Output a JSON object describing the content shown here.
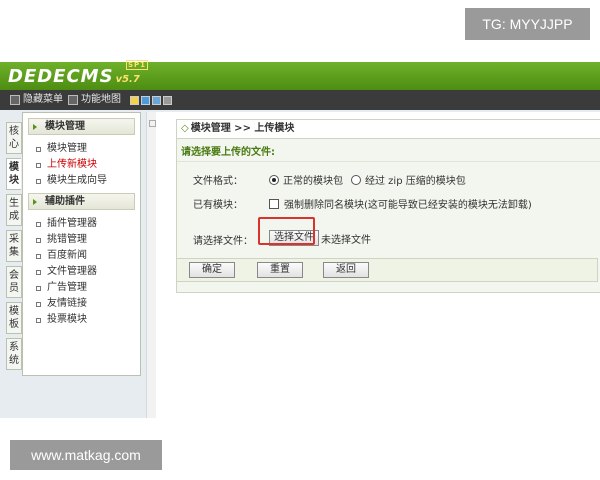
{
  "watermarks": {
    "top": "TG: MYYJJPP",
    "bottom": "www.matkag.com"
  },
  "app": {
    "logo": "DEDECMS",
    "version": "v5.7",
    "badge": "SP1"
  },
  "toolbar": {
    "hide_menu": "隐藏菜单",
    "sitemap": "功能地图"
  },
  "swatch_colors": [
    "#f3d34a",
    "#4a9be0",
    "#6aa6d8",
    "#9a9a9a"
  ],
  "vtabs": [
    "核心",
    "模块",
    "生成",
    "采集",
    "会员",
    "模板",
    "系统"
  ],
  "menu": {
    "group1": {
      "title": "模块管理",
      "items": [
        "模块管理",
        "上传新模块",
        "模块生成向导"
      ]
    },
    "group2": {
      "title": "辅助插件",
      "items": [
        "插件管理器",
        "挑错管理",
        "百度新闻",
        "文件管理器",
        "广告管理",
        "友情链接",
        "投票模块"
      ]
    }
  },
  "main": {
    "breadcrumb": "模块管理 >> 上传模块",
    "breadcrumb_mark": "◇",
    "subtitle": "请选择要上传的文件:",
    "format_label": "文件格式：",
    "format_opt1": "正常的模块包",
    "format_opt2": "经过 zip 压缩的模块包",
    "exists_label": "已有模块：",
    "exists_opt": "强制删除同名模块(这可能导致已经安装的模块无法卸载)",
    "file_label": "请选择文件：",
    "file_button": "选择文件",
    "file_status": "未选择文件"
  },
  "buttons": {
    "ok": "确定",
    "reset": "重置",
    "back": "返回"
  },
  "accent_color": "#5a8f1e",
  "highlight_color": "#d9342b"
}
